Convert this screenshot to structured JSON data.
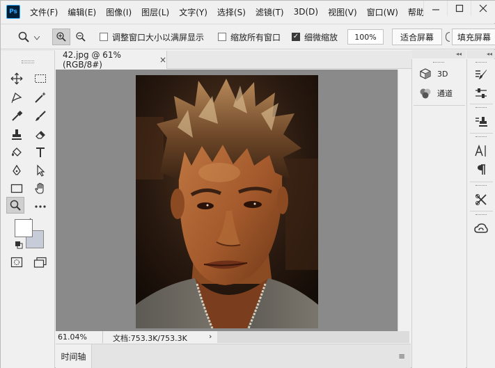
{
  "app": {
    "logo_text": "Ps"
  },
  "menu": [
    "文件(F)",
    "编辑(E)",
    "图像(I)",
    "图层(L)",
    "文字(Y)",
    "选择(S)",
    "滤镜(T)",
    "3D(D)",
    "视图(V)",
    "窗口(W)",
    "帮助"
  ],
  "window_controls": {
    "minimize": "—",
    "maximize": "☐",
    "close": "✕"
  },
  "options_bar": {
    "checkbox_resize": {
      "label": "调整窗口大小以满屏显示",
      "checked": false
    },
    "checkbox_zoom_all": {
      "label": "缩放所有窗口",
      "checked": false
    },
    "checkbox_scrubby": {
      "label": "细微缩放",
      "checked": true,
      "mark": "✓"
    },
    "zoom_field": "100%",
    "fit_screen": "适合屏幕",
    "fill_screen": "填充屏幕"
  },
  "collapse_arrows": "◂◂",
  "document": {
    "tab_title": "42.jpg @ 61%(RGB/8#)",
    "tab_close": "×"
  },
  "status_bar": {
    "zoom": "61.04%",
    "doc_info": "文档:753.3K/753.3K",
    "arrow": "›"
  },
  "timeline": {
    "tab_label": "时间轴",
    "menu_icon": "≡"
  },
  "panel_3d": {
    "items": [
      {
        "label": "3D",
        "icon": "cube-icon"
      },
      {
        "label": "通道",
        "icon": "channels-icon"
      }
    ]
  },
  "colors": {
    "foreground": "#ffffff",
    "background": "#c8ccd8",
    "canvas_bg": "#8a8a8a"
  }
}
